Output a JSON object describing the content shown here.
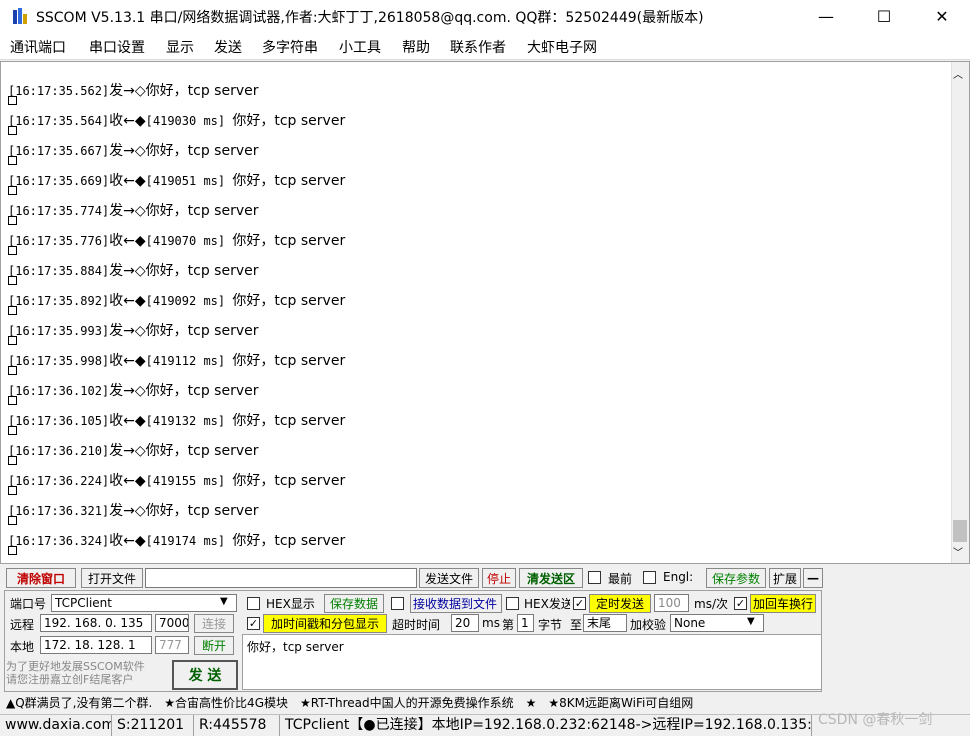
{
  "window": {
    "title": "SSCOM V5.13.1 串口/网络数据调试器,作者:大虾丁丁,2618058@qq.com. QQ群：52502449(最新版本)",
    "minimize": "—",
    "maximize": "☐",
    "close": "✕"
  },
  "menu": [
    "通讯端口",
    "串口设置",
    "显示",
    "发送",
    "多字符串",
    "小工具",
    "帮助",
    "联系作者",
    "大虾电子网"
  ],
  "log": [
    {
      "ts": "[16:17:35.562]",
      "dir": "发→◇",
      "bracket": "",
      "msg": "你好，tcp server"
    },
    {
      "ts": "[16:17:35.564]",
      "dir": "收←◆",
      "bracket": "[419030 ms] ",
      "msg": "你好，tcp server"
    },
    {
      "ts": "[16:17:35.667]",
      "dir": "发→◇",
      "bracket": "",
      "msg": "你好，tcp server"
    },
    {
      "ts": "[16:17:35.669]",
      "dir": "收←◆",
      "bracket": "[419051 ms] ",
      "msg": "你好，tcp server"
    },
    {
      "ts": "[16:17:35.774]",
      "dir": "发→◇",
      "bracket": "",
      "msg": "你好，tcp server"
    },
    {
      "ts": "[16:17:35.776]",
      "dir": "收←◆",
      "bracket": "[419070 ms] ",
      "msg": "你好，tcp server"
    },
    {
      "ts": "[16:17:35.884]",
      "dir": "发→◇",
      "bracket": "",
      "msg": "你好，tcp server"
    },
    {
      "ts": "[16:17:35.892]",
      "dir": "收←◆",
      "bracket": "[419092 ms] ",
      "msg": "你好，tcp server"
    },
    {
      "ts": "[16:17:35.993]",
      "dir": "发→◇",
      "bracket": "",
      "msg": "你好，tcp server"
    },
    {
      "ts": "[16:17:35.998]",
      "dir": "收←◆",
      "bracket": "[419112 ms] ",
      "msg": "你好，tcp server"
    },
    {
      "ts": "[16:17:36.102]",
      "dir": "发→◇",
      "bracket": "",
      "msg": "你好，tcp server"
    },
    {
      "ts": "[16:17:36.105]",
      "dir": "收←◆",
      "bracket": "[419132 ms] ",
      "msg": "你好，tcp server"
    },
    {
      "ts": "[16:17:36.210]",
      "dir": "发→◇",
      "bracket": "",
      "msg": "你好，tcp server"
    },
    {
      "ts": "[16:17:36.224]",
      "dir": "收←◆",
      "bracket": "[419155 ms] ",
      "msg": "你好，tcp server"
    },
    {
      "ts": "[16:17:36.321]",
      "dir": "发→◇",
      "bracket": "",
      "msg": "你好，tcp server"
    },
    {
      "ts": "[16:17:36.324]",
      "dir": "收←◆",
      "bracket": "[419174 ms] ",
      "msg": "你好，tcp server"
    }
  ],
  "toolbar": {
    "clear_window": "清除窗口",
    "open_file": "打开文件",
    "file_path": "",
    "send_file": "发送文件",
    "stop": "停止",
    "clear_send": "清发送区",
    "front_label": "最前",
    "english_label": "Engl:",
    "save_params": "保存参数",
    "expand": "扩展",
    "collapse": "—"
  },
  "config": {
    "port_label": "端口号",
    "port_value": "TCPClient",
    "hex_display": "HEX显示",
    "save_data": "保存数据",
    "recv_to_file": "接收数据到文件",
    "hex_send": "HEX发送",
    "timed_send": "定时发送",
    "interval_value": "100",
    "interval_unit": "ms/次",
    "add_crlf": "加回车换行",
    "remote_label": "远程",
    "remote_ip": "192. 168. 0. 135",
    "remote_port": "7000",
    "connect_btn": "连接",
    "timestamp_label": "加时间戳和分包显示",
    "timeout_label": "超时时间",
    "timeout_value": "20",
    "timeout_unit": "ms",
    "nth_label": "第",
    "nth_value": "1",
    "byte_label": "字节",
    "to_label": "至",
    "tail_value": "末尾",
    "checksum_label": "加校验",
    "checksum_value": "None",
    "local_label": "本地",
    "local_ip": "172. 18. 128. 1",
    "local_port": "777",
    "disconnect_btn": "断开",
    "promo": "为了更好地发展SSCOM软件 请您注册嘉立创F结尾客户",
    "send_btn": "发 送",
    "send_text": "你好，tcp server"
  },
  "ticker": "▲Q群满员了,没有第二个群.　★合宙高性价比4G模块　★RT-Thread中国人的开源免费操作系统　★　★8KM远距离WiFi可自组网",
  "status": {
    "site": "www.daxia.com",
    "sent": "S:211201",
    "recv": "R:445578",
    "conn": "TCPclient【●已连接】本地IP=192.168.0.232:62148->远程IP=192.168.0.135:",
    "watermark": "CSDN @春秋一剑"
  }
}
